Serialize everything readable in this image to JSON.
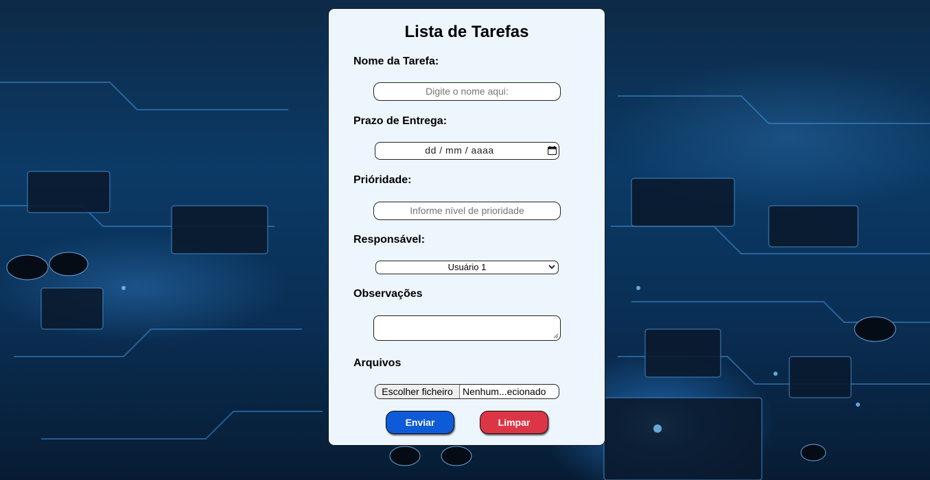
{
  "form": {
    "title": "Lista de Tarefas",
    "task_name": {
      "label": "Nome da Tarefa:",
      "placeholder": "Digite o nome aqui:"
    },
    "deadline": {
      "label": "Prazo de Entrega:",
      "placeholder": "dd / mm / aaaa"
    },
    "priority": {
      "label": "Prióridade:",
      "placeholder": "Informe nível de prioridade"
    },
    "responsible": {
      "label": "Responsável:",
      "selected": "Usuário 1"
    },
    "notes": {
      "label": "Observações"
    },
    "files": {
      "label": "Arquivos",
      "choose_label": "Escolher ficheiro",
      "status": "Nenhum...ecionado"
    },
    "buttons": {
      "submit": "Enviar",
      "clear": "Limpar"
    }
  },
  "colors": {
    "card_background": "#eef6fd",
    "submit_button": "#0d5bd6",
    "clear_button": "#dc3545"
  }
}
